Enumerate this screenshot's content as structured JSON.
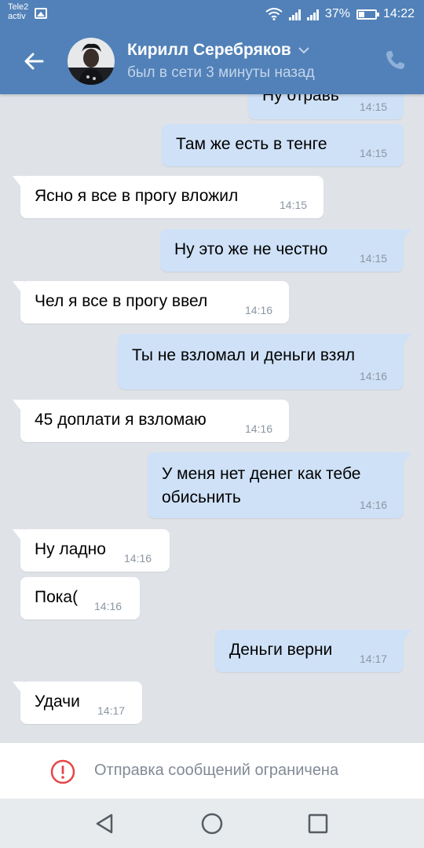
{
  "status_bar": {
    "carrier_line1": "Tele2",
    "carrier_line2": "activ",
    "battery_percent": "37%",
    "battery_level": 0.37,
    "time": "14:22",
    "icons": [
      "image-icon",
      "wifi-icon",
      "signal-icon",
      "signal-icon",
      "battery-icon"
    ]
  },
  "header": {
    "contact_name": "Кирилл Серебряков",
    "contact_status": "был в сети 3 минуты назад",
    "icons": [
      "back-arrow-icon",
      "avatar",
      "chevron-down-icon",
      "phone-icon"
    ]
  },
  "messages": [
    {
      "dir": "out",
      "text": "Ну отравь",
      "time": "14:15"
    },
    {
      "dir": "out",
      "text": "Там же есть в тенге",
      "time": "14:15"
    },
    {
      "dir": "in",
      "text": "Ясно я все в прогу вложил",
      "time": "14:15"
    },
    {
      "dir": "out",
      "text": "Ну это же не честно",
      "time": "14:15"
    },
    {
      "dir": "in",
      "text": "Чел я все в прогу ввел",
      "time": "14:16"
    },
    {
      "dir": "out",
      "text": "Ты не взломал и деньги взял",
      "time": "14:16"
    },
    {
      "dir": "in",
      "text": "45 доплати я взломаю",
      "time": "14:16"
    },
    {
      "dir": "out",
      "text": "У меня нет денег как тебе",
      "text2": "обисьнить",
      "time": "14:16"
    },
    {
      "dir": "in",
      "text": "Ну ладно",
      "time": "14:16"
    },
    {
      "dir": "in",
      "text": "Пока(",
      "time": "14:16"
    },
    {
      "dir": "out",
      "text": "Деньги верни",
      "time": "14:17"
    },
    {
      "dir": "in",
      "text": "Удачи",
      "time": "14:17"
    }
  ],
  "restriction": {
    "label": "Отправка сообщений ограничена",
    "icon": "alert-circle-icon"
  },
  "navbar": {
    "icons": [
      "nav-back-icon",
      "nav-home-icon",
      "nav-recents-icon"
    ]
  },
  "colors": {
    "header_blue": "#5181b8",
    "outgoing_bubble": "#cfe1f7",
    "incoming_bubble": "#ffffff",
    "chat_background": "#dfe3e8",
    "alert_red": "#e64646"
  }
}
